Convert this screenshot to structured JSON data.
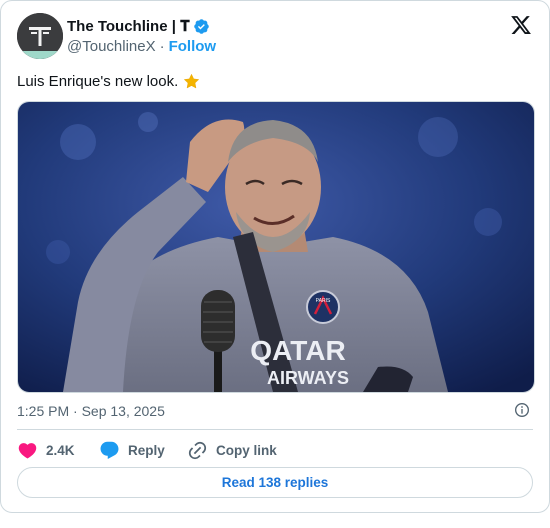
{
  "author": {
    "name": "The Touchline | 𝐓",
    "handle": "@TouchlineX",
    "separator": "·",
    "follow_label": "Follow",
    "avatar_letter": "T"
  },
  "tweet": {
    "text": "Luis Enrique's new look.",
    "emoji_icon": "star-icon"
  },
  "media": {
    "jersey_crest": "PARIS",
    "jersey_sponsor_line1": "QATAR",
    "jersey_sponsor_line2": "AIRWAYS"
  },
  "meta": {
    "timestamp": "1:25 PM · Sep 13, 2025"
  },
  "actions": {
    "like_count": "2.4K",
    "reply_label": "Reply",
    "copy_label": "Copy link"
  },
  "footer": {
    "read_replies_label": "Read 138 replies"
  },
  "colors": {
    "accent": "#1d9bf0",
    "like": "#f91880",
    "muted": "#536471",
    "border": "#cfd9de"
  }
}
